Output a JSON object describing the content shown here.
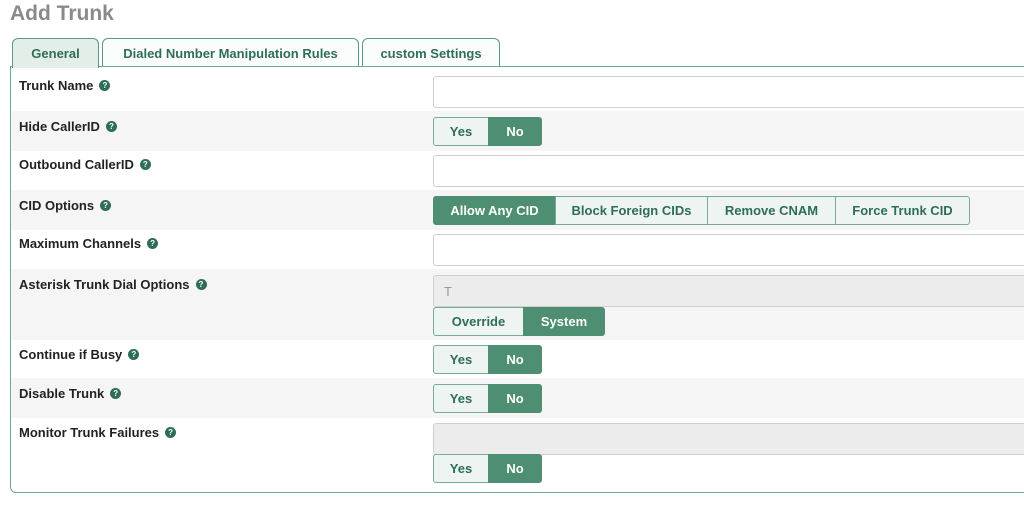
{
  "page": {
    "title": "Add Trunk"
  },
  "tabs": [
    {
      "label": "General",
      "active": true
    },
    {
      "label": "Dialed Number Manipulation Rules",
      "active": false
    },
    {
      "label": "custom Settings",
      "active": false
    }
  ],
  "help_icon_glyph": "?",
  "form": {
    "trunk_name": {
      "label": "Trunk Name",
      "value": ""
    },
    "hide_callerid": {
      "label": "Hide CallerID",
      "options": [
        "Yes",
        "No"
      ],
      "selected": "No"
    },
    "outbound_callerid": {
      "label": "Outbound CallerID",
      "value": ""
    },
    "cid_options": {
      "label": "CID Options",
      "options": [
        "Allow Any CID",
        "Block Foreign CIDs",
        "Remove CNAM",
        "Force Trunk CID"
      ],
      "selected": "Allow Any CID"
    },
    "maximum_channels": {
      "label": "Maximum Channels",
      "value": ""
    },
    "dial_options": {
      "label": "Asterisk Trunk Dial Options",
      "value": "T",
      "options": [
        "Override",
        "System"
      ],
      "selected": "System"
    },
    "continue_if_busy": {
      "label": "Continue if Busy",
      "options": [
        "Yes",
        "No"
      ],
      "selected": "No"
    },
    "disable_trunk": {
      "label": "Disable Trunk",
      "options": [
        "Yes",
        "No"
      ],
      "selected": "No"
    },
    "monitor_trunk_failures": {
      "label": "Monitor Trunk Failures",
      "value": "",
      "options": [
        "Yes",
        "No"
      ],
      "selected": "No"
    }
  },
  "colors": {
    "accent": "#4e8f73",
    "tab_text": "#2f6e56",
    "title": "#8a8a8a"
  }
}
